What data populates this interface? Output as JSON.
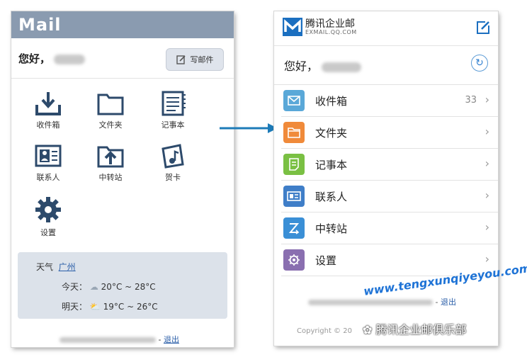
{
  "left": {
    "logo": "Mail",
    "greeting": "您好，",
    "write_label": "写邮件",
    "grid": [
      {
        "label": "收件箱",
        "icon": "inbox-download-icon"
      },
      {
        "label": "文件夹",
        "icon": "folder-icon"
      },
      {
        "label": "记事本",
        "icon": "notebook-icon"
      },
      {
        "label": "联系人",
        "icon": "contacts-card-icon"
      },
      {
        "label": "中转站",
        "icon": "transfer-folder-icon"
      },
      {
        "label": "贺卡",
        "icon": "greeting-card-icon"
      },
      {
        "label": "设置",
        "icon": "gear-icon"
      }
    ],
    "weather": {
      "title": "天气",
      "city": "广州",
      "today_label": "今天：",
      "today_range": "20°C ~ 28°C",
      "tomorrow_label": "明天：",
      "tomorrow_range": "19°C ~ 26°C"
    },
    "footer_logout": "退出"
  },
  "right": {
    "brand": "腾讯企业邮",
    "brand_sub": "EXMAIL.QQ.COM",
    "greeting": "您好，",
    "items": [
      {
        "label": "收件箱",
        "count": "33",
        "color": "#5aa8d8"
      },
      {
        "label": "文件夹",
        "count": "",
        "color": "#f08a3a"
      },
      {
        "label": "记事本",
        "count": "",
        "color": "#7ac043"
      },
      {
        "label": "联系人",
        "count": "",
        "color": "#3f7ec8"
      },
      {
        "label": "中转站",
        "count": "",
        "color": "#3a8fd6"
      },
      {
        "label": "设置",
        "count": "",
        "color": "#8a6fb0"
      }
    ],
    "footer_logout": "退出",
    "copyright": "Copyright © 20"
  },
  "watermark": {
    "url": "www.tengxunqiyeyou.com",
    "club": "腾讯企业邮俱乐部"
  }
}
